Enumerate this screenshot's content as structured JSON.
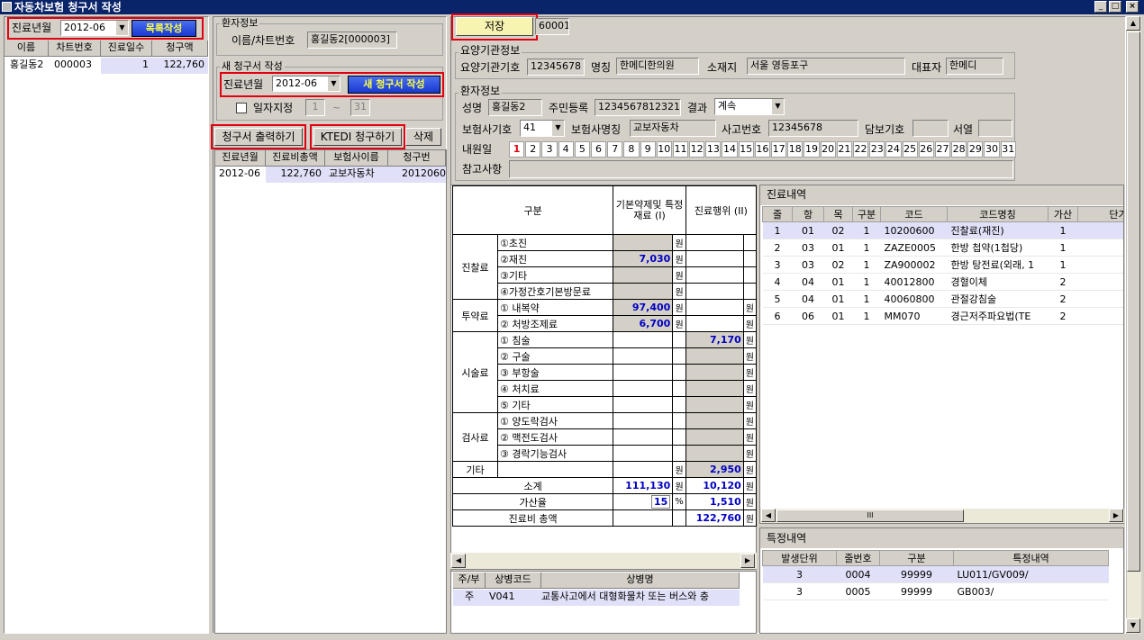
{
  "window": {
    "title": "자동차보험 청구서 작성"
  },
  "left": {
    "month_label": "진료년월",
    "month_value": "2012-06",
    "list_button": "목록작성",
    "columns": [
      "이름",
      "차트번호",
      "진료일수",
      "청구액"
    ],
    "rows": [
      {
        "name": "홍길동2",
        "chart": "000003",
        "days": "1",
        "amount": "122,760"
      }
    ]
  },
  "middle": {
    "patient_group": "환자정보",
    "name_chart_label": "이름/차트번호",
    "name_chart_value": "홍길동2[000003]",
    "new_group": "새 청구서 작성",
    "month_label": "진료년월",
    "month_value": "2012-06",
    "new_button": "새 청구서 작성",
    "date_check_label": "일자지정",
    "date_from": "1",
    "date_sep": "~",
    "date_to": "31",
    "print_button": "청구서 출력하기",
    "ktedi_button": "KTEDI 청구하기",
    "delete_button": "삭제",
    "columns": [
      "진료년월",
      "진료비총액",
      "보험사이름",
      "청구번"
    ],
    "rows": [
      {
        "month": "2012-06",
        "total": "122,760",
        "insurer": "교보자동차",
        "claim": "2012060"
      }
    ]
  },
  "top": {
    "save_button": "저장",
    "claim_no": "60001"
  },
  "institution": {
    "group": "요양기관정보",
    "code_label": "요양기관기호",
    "code": "12345678",
    "name_label": "명칭",
    "name": "한메디한의원",
    "addr_label": "소재지",
    "addr": "서울 영등포구",
    "rep_label": "대표자",
    "rep": "한메디"
  },
  "patient": {
    "group": "환자정보",
    "name_label": "성명",
    "name": "홍길동2",
    "id_label": "주민등록",
    "id": "1234567812321",
    "result_label": "결과",
    "result": "계속",
    "ins_code_label": "보험사기호",
    "ins_code": "41",
    "ins_name_label": "보험사명칭",
    "ins_name": "교보자동차",
    "accident_label": "사고번호",
    "accident": "12345678",
    "guarantee_label": "담보기호",
    "guarantee": "",
    "seoyeol_label": "서열",
    "seoyeol": "",
    "visit_label": "내원일",
    "days": [
      "1",
      "2",
      "3",
      "4",
      "5",
      "6",
      "7",
      "8",
      "9",
      "10",
      "11",
      "12",
      "13",
      "14",
      "15",
      "16",
      "17",
      "18",
      "19",
      "20",
      "21",
      "22",
      "23",
      "24",
      "25",
      "26",
      "27",
      "28",
      "29",
      "30",
      "31"
    ],
    "active_day": "1",
    "note_label": "참고사항",
    "note": ""
  },
  "cost": {
    "h_category": "구분",
    "h_basic": "기본약제및 특정재료 (I)",
    "h_act": "진료행위 (II)",
    "won": "원",
    "groups": [
      {
        "name": "진찰료",
        "items": [
          {
            "label": "①초진",
            "basic": "",
            "act": ""
          },
          {
            "label": "②재진",
            "basic": "7,030",
            "act": ""
          },
          {
            "label": "③기타",
            "basic": "",
            "act": ""
          },
          {
            "label": "④가정간호기본방문료",
            "basic": "",
            "act": ""
          }
        ]
      },
      {
        "name": "투약료",
        "items": [
          {
            "label": "① 내복약",
            "basic": "97,400",
            "act": ""
          },
          {
            "label": "② 처방조제료",
            "basic": "6,700",
            "act": ""
          }
        ]
      },
      {
        "name": "시술료",
        "items": [
          {
            "label": "① 침술",
            "basic": "",
            "act": "7,170"
          },
          {
            "label": "② 구술",
            "basic": "",
            "act": ""
          },
          {
            "label": "③ 부항술",
            "basic": "",
            "act": ""
          },
          {
            "label": "④ 처치료",
            "basic": "",
            "act": ""
          },
          {
            "label": "⑤ 기타",
            "basic": "",
            "act": ""
          }
        ]
      },
      {
        "name": "검사료",
        "items": [
          {
            "label": "① 양도락검사",
            "basic": "",
            "act": ""
          },
          {
            "label": "② 맥전도검사",
            "basic": "",
            "act": ""
          },
          {
            "label": "③ 경락기능검사",
            "basic": "",
            "act": ""
          }
        ]
      }
    ],
    "etc_label": "기타",
    "etc_basic": "",
    "etc_act": "2,950",
    "subtotal_label": "소계",
    "subtotal_basic": "111,130",
    "subtotal_act": "10,120",
    "rate_label": "가산율",
    "rate": "15",
    "rate_unit": "%",
    "rate_act": "1,510",
    "total_label": "진료비 총액",
    "total": "122,760"
  },
  "disease": {
    "columns": [
      "주/부",
      "상병코드",
      "상병명"
    ],
    "rows": [
      {
        "type": "주",
        "code": "V041",
        "name": "교통사고에서 대형화물차 또는 버스와 충"
      }
    ]
  },
  "treat": {
    "title": "진료내역",
    "columns": [
      "줄",
      "항",
      "목",
      "구분",
      "코드",
      "코드명칭",
      "가산",
      "단가"
    ],
    "rows": [
      {
        "line": "1",
        "hang": "01",
        "mok": "02",
        "div": "1",
        "code": "10200600",
        "name": "진찰료(재진)",
        "add": "1",
        "price": "7,0"
      },
      {
        "line": "2",
        "hang": "03",
        "mok": "01",
        "div": "1",
        "code": "ZAZE0005",
        "name": "한방 첩약(1첩당)",
        "add": "1",
        "price": "4,8"
      },
      {
        "line": "3",
        "hang": "03",
        "mok": "02",
        "div": "1",
        "code": "ZA900002",
        "name": "한방 탕전료(외래, 1",
        "add": "1",
        "price": "6,7"
      },
      {
        "line": "4",
        "hang": "04",
        "mok": "01",
        "div": "1",
        "code": "40012800",
        "name": "경혈이체",
        "add": "2",
        "price": "4,1"
      },
      {
        "line": "5",
        "hang": "04",
        "mok": "01",
        "div": "1",
        "code": "40060800",
        "name": "관절강침술",
        "add": "2",
        "price": "3,0"
      },
      {
        "line": "6",
        "hang": "06",
        "mok": "01",
        "div": "1",
        "code": "MM070",
        "name": "경근저주파요법(TE",
        "add": "2",
        "price": "2,9"
      }
    ]
  },
  "special": {
    "title": "특정내역",
    "columns": [
      "발생단위",
      "줄번호",
      "구분",
      "특정내역"
    ],
    "rows": [
      {
        "unit": "3",
        "line": "0004",
        "div": "99999",
        "detail": "LU011/GV009/"
      },
      {
        "unit": "3",
        "line": "0005",
        "div": "99999",
        "detail": "GB003/"
      }
    ]
  }
}
